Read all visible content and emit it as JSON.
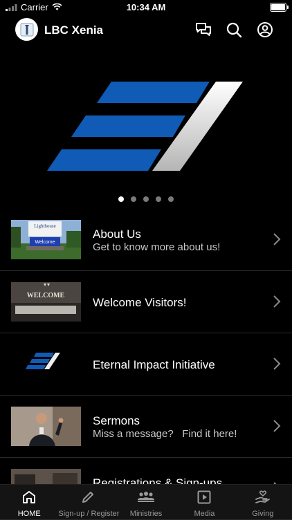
{
  "status_bar": {
    "carrier": "Carrier",
    "time": "10:34 AM"
  },
  "header": {
    "title": "LBC Xenia",
    "icons": [
      "chat-icon",
      "search-icon",
      "account-icon"
    ]
  },
  "carousel": {
    "page_count": 5,
    "active_index": 0
  },
  "list": [
    {
      "title": "About Us",
      "subtitle": "Get to know more about us!",
      "thumb": "Lighthouse sign",
      "sign_text_top": "Lighthouse",
      "sign_text_bottom": "Welcome"
    },
    {
      "title": "Welcome Visitors!",
      "subtitle": "",
      "thumb": "lobby",
      "wall_text": "WELCOME"
    },
    {
      "title": "Eternal Impact Initiative",
      "subtitle": "",
      "thumb": "stripes logo"
    },
    {
      "title": "Sermons",
      "subtitle": "Miss a message?   Find it here!",
      "thumb": "speaker"
    },
    {
      "title": "Registrations & Sign-ups",
      "subtitle": "",
      "thumb": "registration"
    }
  ],
  "tabs": [
    {
      "label": "HOME",
      "icon": "home-icon",
      "active": true
    },
    {
      "label": "Sign-up / Register",
      "icon": "pencil-icon",
      "active": false
    },
    {
      "label": "Ministries",
      "icon": "group-icon",
      "active": false
    },
    {
      "label": "Media",
      "icon": "play-icon",
      "active": false
    },
    {
      "label": "Giving",
      "icon": "giving-icon",
      "active": false
    }
  ],
  "colors": {
    "accent_blue": "#0f5bb5",
    "background": "#000000",
    "tabbar": "#141414"
  }
}
